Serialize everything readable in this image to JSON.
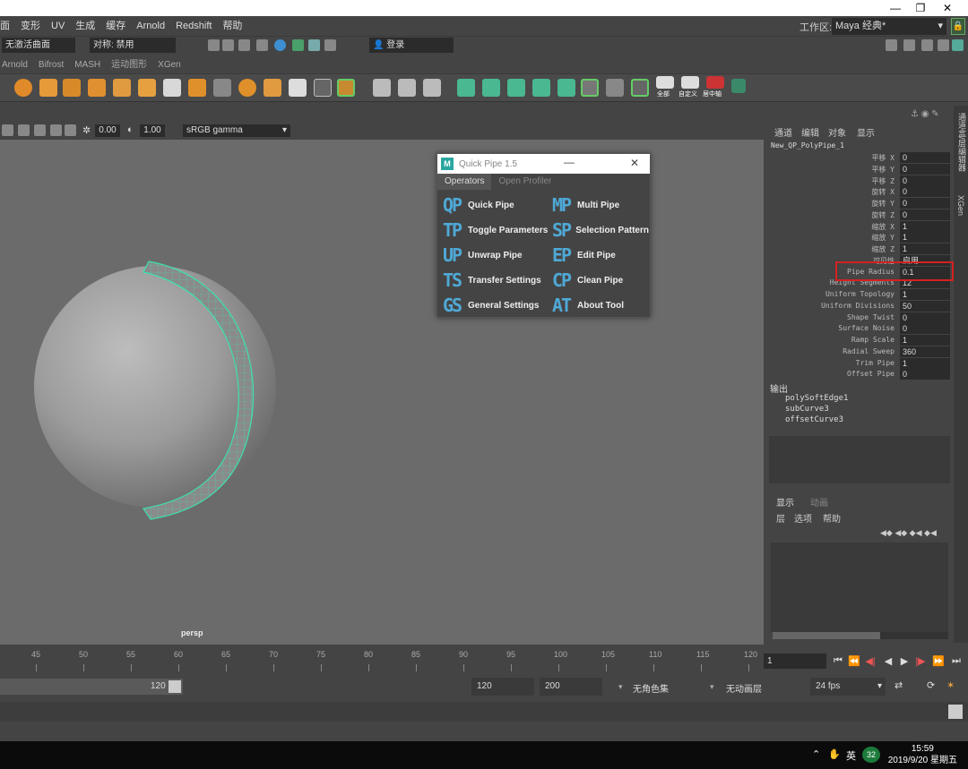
{
  "window": {
    "minimize": "—",
    "restore": "❐",
    "close": "✕"
  },
  "menubar": {
    "items": [
      "面",
      "变形",
      "UV",
      "生成",
      "缓存",
      "Arnold",
      "Redshift",
      "帮助"
    ],
    "workspace_label": "工作区:",
    "workspace_value": "Maya 经典*"
  },
  "statusline": {
    "mode_value": "无激活曲面",
    "symmetry_value": "对称: 禁用",
    "login_value": "登录"
  },
  "shelf_tabs": [
    "Arnold",
    "Bifrost",
    "MASH",
    "运动图形",
    "XGen"
  ],
  "shelf_icon_labels": [
    "全部",
    "自定义",
    "居中轴"
  ],
  "viewport": {
    "exposure": "0.00",
    "gamma_value": "1.00",
    "color_space": "sRGB gamma",
    "camera": "persp"
  },
  "quick_pipe": {
    "title": "Quick Pipe 1.5",
    "logo": "M",
    "tabs": [
      "Operators",
      "Open Profiler"
    ],
    "items": [
      {
        "abbr": "QP",
        "label": "Quick Pipe"
      },
      {
        "abbr": "MP",
        "label": "Multi Pipe"
      },
      {
        "abbr": "TP",
        "label": "Toggle Parameters"
      },
      {
        "abbr": "SP",
        "label": "Selection Pattern"
      },
      {
        "abbr": "UP",
        "label": "Unwrap Pipe"
      },
      {
        "abbr": "EP",
        "label": "Edit Pipe"
      },
      {
        "abbr": "TS",
        "label": "Transfer Settings"
      },
      {
        "abbr": "CP",
        "label": "Clean Pipe"
      },
      {
        "abbr": "GS",
        "label": "General Settings"
      },
      {
        "abbr": "AT",
        "label": "About Tool"
      }
    ]
  },
  "channel_box": {
    "menu": [
      "通道",
      "编辑",
      "对象",
      "显示"
    ],
    "node_name": "New_QP_PolyPipe_1",
    "attributes": [
      {
        "label": "平移 X",
        "value": "0"
      },
      {
        "label": "平移 Y",
        "value": "0"
      },
      {
        "label": "平移 Z",
        "value": "0"
      },
      {
        "label": "旋转 X",
        "value": "0"
      },
      {
        "label": "旋转 Y",
        "value": "0"
      },
      {
        "label": "旋转 Z",
        "value": "0"
      },
      {
        "label": "缩放 X",
        "value": "1"
      },
      {
        "label": "缩放 Y",
        "value": "1"
      },
      {
        "label": "缩放 Z",
        "value": "1"
      },
      {
        "label": "可见性",
        "value": "启用"
      },
      {
        "label": "Pipe Radius",
        "value": "0.1"
      },
      {
        "label": "Height Segments",
        "value": "12"
      },
      {
        "label": "Uniform Topology",
        "value": "1"
      },
      {
        "label": "Uniform Divisions",
        "value": "50"
      },
      {
        "label": "Shape Twist",
        "value": "0"
      },
      {
        "label": "Surface Noise",
        "value": "0"
      },
      {
        "label": "Ramp Scale",
        "value": "1"
      },
      {
        "label": "Radial Sweep",
        "value": "360"
      },
      {
        "label": "Trim Pipe",
        "value": "1"
      },
      {
        "label": "Offset Pipe",
        "value": "0"
      }
    ],
    "outputs_label": "输出",
    "outputs": [
      "polySoftEdge1",
      "subCurve3",
      "offsetCurve3"
    ]
  },
  "layer_editor": {
    "tabs": [
      "显示",
      "动画"
    ],
    "menu": [
      "层",
      "选项",
      "帮助"
    ]
  },
  "side_tabs": [
    "通道盒/层编辑器",
    "XGen"
  ],
  "time_slider": {
    "ticks": [
      "45",
      "50",
      "55",
      "60",
      "65",
      "70",
      "75",
      "80",
      "85",
      "90",
      "95",
      "100",
      "105",
      "110",
      "115",
      "120"
    ],
    "current_frame": "1"
  },
  "range": {
    "range_end": "120",
    "anim_end": "120",
    "playback_end": "200",
    "character_set": "无角色集",
    "anim_layer": "无动画层",
    "fps": "24 fps"
  },
  "taskbar": {
    "ime": "英",
    "badge": "32",
    "time": "15:59",
    "date": "2019/9/20 星期五"
  },
  "colors": {
    "accent_pipe": "#4fa9d6",
    "highlight_box": "#d62020",
    "wireframe": "#3fe0b0"
  }
}
